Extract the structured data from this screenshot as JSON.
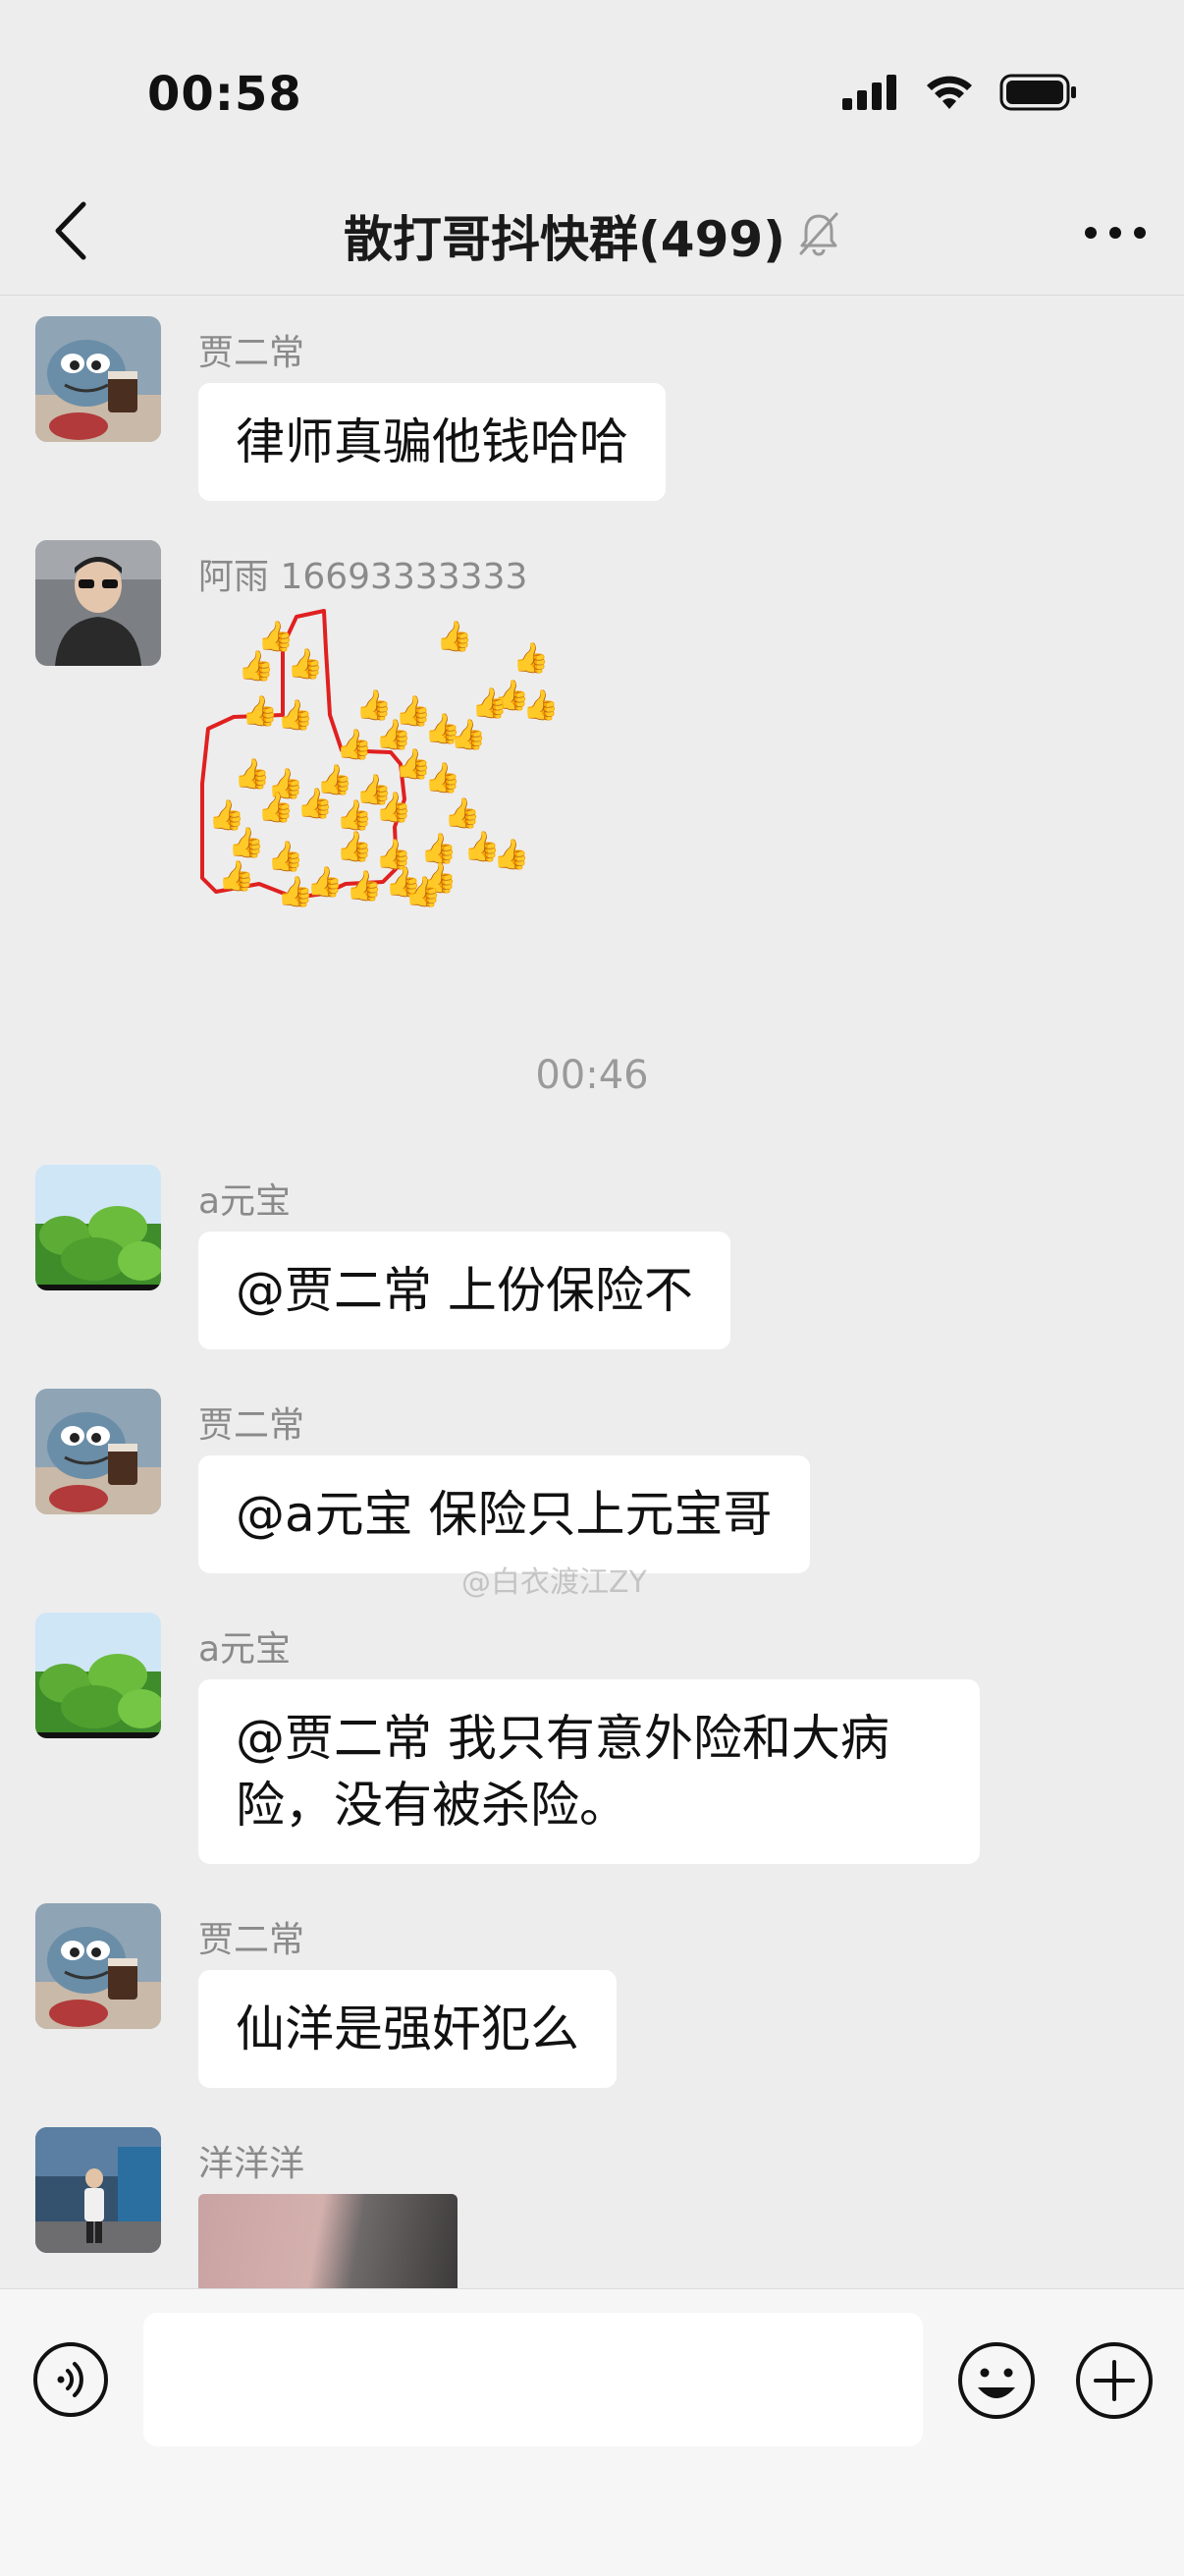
{
  "status_bar": {
    "time": "00:58"
  },
  "header": {
    "title": "散打哥抖快群(499)",
    "muted": true
  },
  "messages": [
    {
      "sender": "贾二常",
      "text": "律师真骗他钱哈哈",
      "avatar": "cartoon-figure-with-coffee"
    },
    {
      "sender": "阿雨 16693333333",
      "type": "sticker",
      "sticker": "thumbs-up-outline-of-thumbs",
      "avatar": "man-with-sunglasses-in-car"
    },
    {
      "sender": "a元宝",
      "text": "@贾二常 上份保险不",
      "avatar": "green-clover-field"
    },
    {
      "sender": "贾二常",
      "text": "@a元宝 保险只上元宝哥",
      "avatar": "cartoon-figure-with-coffee"
    },
    {
      "sender": "a元宝",
      "text": "@贾二常 我只有意外险和大病险，没有被杀险。",
      "avatar": "green-clover-field"
    },
    {
      "sender": "贾二常",
      "text": "仙洋是强奸犯么",
      "avatar": "cartoon-figure-with-coffee"
    },
    {
      "sender": "洋洋洋",
      "type": "image",
      "avatar": "street-photo-person"
    }
  ],
  "timestamp": "00:46",
  "watermark": "@白衣渡江ZY",
  "input": {
    "placeholder": ""
  },
  "colors": {
    "background": "#ededed",
    "bubble": "#ffffff",
    "sender_text": "#8a8a8a",
    "sticker_outline": "#e02020"
  }
}
